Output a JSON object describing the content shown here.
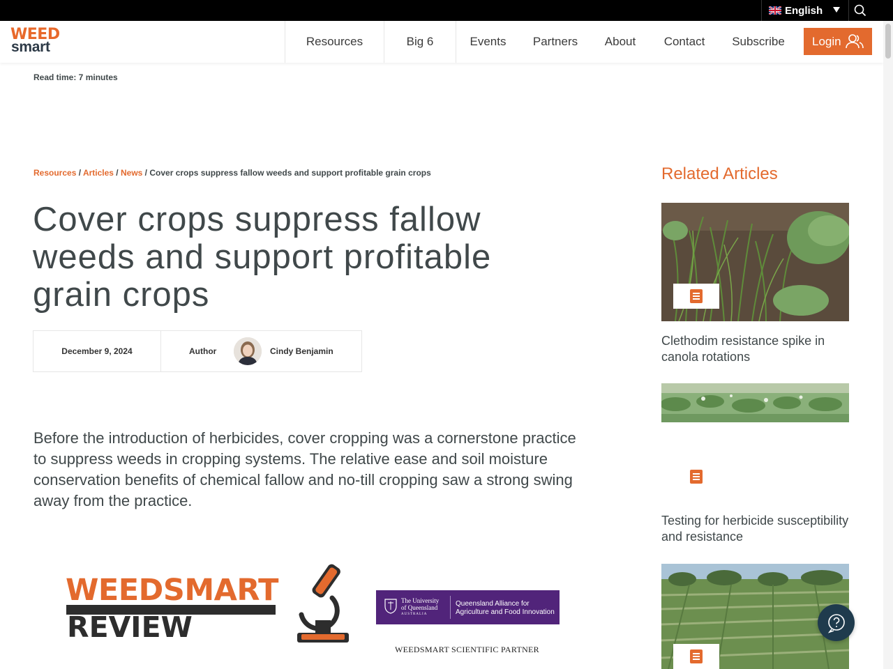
{
  "topbar": {
    "language": "English",
    "language_flag": "uk-flag-icon"
  },
  "header": {
    "logo_top": "WEED",
    "logo_bottom": "smart",
    "nav": [
      "Resources",
      "Big 6",
      "Events",
      "Partners",
      "About",
      "Contact",
      "Subscribe"
    ],
    "login_label": "Login"
  },
  "article": {
    "read_time": "Read time: 7 minutes",
    "breadcrumb": {
      "items": [
        "Resources",
        "Articles",
        "News"
      ],
      "current": "Cover crops suppress fallow weeds and support profitable grain crops"
    },
    "title": "Cover crops suppress fallow weeds and support profitable grain crops",
    "date": "December 9, 2024",
    "author_label": "Author",
    "author_name": "Cindy Benjamin",
    "intro": "Before the introduction of herbicides, cover cropping was a cornerstone practice to suppress weeds in cropping systems. The relative ease and soil moisture conservation benefits of chemical fallow and no-till cropping saw a strong swing away from the practice."
  },
  "banner": {
    "weedsmart": "WEEDSMART",
    "review": "REVIEW",
    "uq_name": "THE UNIVERSITY OF QUEENSLAND AUSTRALIA",
    "uq_name_line1": "The University",
    "uq_name_line2": "of Queensland",
    "uq_name_line3": "AUSTRALIA",
    "qaafi_line1": "Queensland Alliance for",
    "qaafi_line2": "Agriculture and Food Innovation",
    "partner": "WEEDSMART SCIENTIFIC PARTNER"
  },
  "sidebar": {
    "heading": "Related Articles",
    "cards": [
      {
        "title": "Clethodim resistance spike in canola rotations",
        "icon": "document-icon"
      },
      {
        "title": "Testing for herbicide susceptibility and resistance",
        "icon": "document-icon"
      },
      {
        "title": "",
        "icon": "document-icon"
      }
    ]
  },
  "colors": {
    "accent": "#e36a2e",
    "text": "#40484a",
    "topbar": "#000000",
    "uq_purple": "#51247a"
  }
}
